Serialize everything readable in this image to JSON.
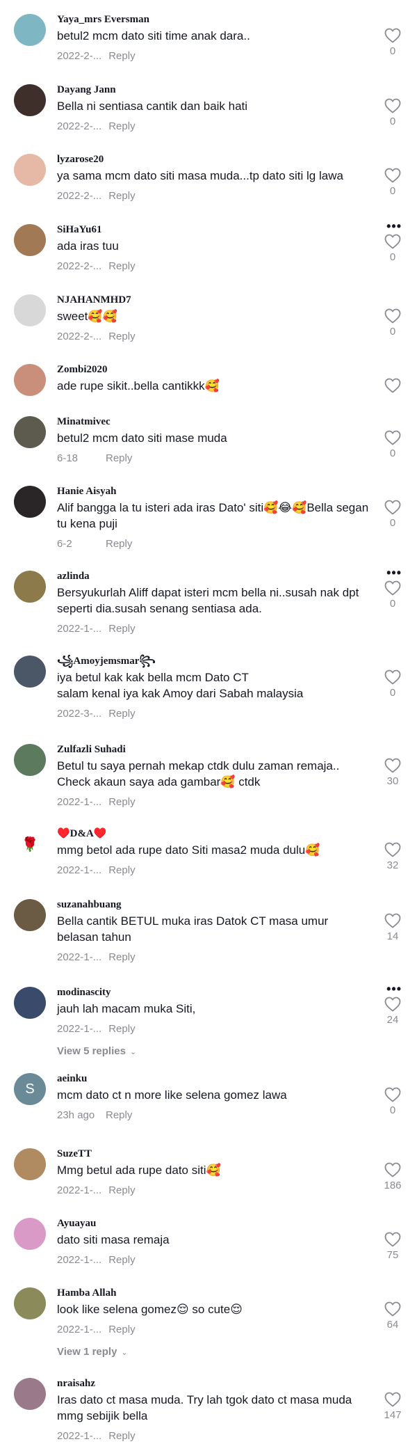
{
  "comments": [
    {
      "username": "Yaya_mrs Eversman",
      "text": "betul2 mcm dato siti time anak dara..",
      "date": "2022-2-...",
      "reply": "Reply",
      "likes": "0",
      "more": false,
      "avatar_color": "#7fb6c4",
      "avatar_letter": ""
    },
    {
      "username": "Dayang Jann",
      "text": "Bella ni sentiasa cantik dan baik hati",
      "date": "2022-2-...",
      "reply": "Reply",
      "likes": "0",
      "more": false,
      "avatar_color": "#3e2f2a",
      "avatar_letter": ""
    },
    {
      "username": "lyzarose20",
      "text": "ya sama mcm dato siti masa muda...tp dato siti lg lawa",
      "date": "2022-2-...",
      "reply": "Reply",
      "likes": "0",
      "more": false,
      "avatar_color": "#e6b8a6",
      "avatar_letter": ""
    },
    {
      "username": "SiHaYu61",
      "text": "ada iras tuu",
      "date": "2022-2-...",
      "reply": "Reply",
      "likes": "0",
      "more": true,
      "avatar_color": "#a17a55",
      "avatar_letter": ""
    },
    {
      "username": "NJAHANMHD7",
      "text": "sweet🥰🥰",
      "date": "2022-2-...",
      "reply": "Reply",
      "likes": "0",
      "more": false,
      "avatar_color": "#d8d8d8",
      "avatar_letter": ""
    },
    {
      "username": "Zombi2020",
      "text": "ade rupe sikit..bella cantikkk🥰",
      "date": "",
      "reply": "",
      "likes": "",
      "more": false,
      "avatar_color": "#c98f7a",
      "avatar_letter": ""
    },
    {
      "username": "Minatmivec",
      "text": "betul2 mcm dato siti mase muda",
      "date": "6-18",
      "reply": "Reply",
      "likes": "0",
      "more": false,
      "avatar_color": "#5d5a4e",
      "avatar_letter": ""
    },
    {
      "username": "Hanie Aisyah",
      "text": "Alif bangga la tu isteri ada iras Dato' siti🥰😂🥰Bella segan tu kena puji",
      "date": "6-2",
      "reply": "Reply",
      "likes": "0",
      "more": false,
      "avatar_color": "#2a2526",
      "avatar_letter": ""
    },
    {
      "username": "azlinda",
      "text": "Bersyukurlah Aliff dapat isteri mcm bella ni..susah nak dpt seperti dia.susah senang sentiasa ada.",
      "date": "2022-1-...",
      "reply": "Reply",
      "likes": "0",
      "more": true,
      "avatar_color": "#8c7a4b",
      "avatar_letter": ""
    },
    {
      "username": "꧁Amoyjemsmar꧂",
      "text": "iya betul kak kak bella mcm Dato CT\nsalam kenal iya kak Amoy dari Sabah malaysia",
      "date": "2022-3-...",
      "reply": "Reply",
      "likes": "0",
      "more": false,
      "avatar_color": "#4b5666",
      "avatar_letter": ""
    },
    {
      "username": "Zulfazli Suhadi",
      "text": "Betul tu saya pernah mekap ctdk dulu zaman remaja..\nCheck akaun saya ada gambar🥰 ctdk",
      "date": "2022-1-...",
      "reply": "Reply",
      "likes": "30",
      "more": false,
      "avatar_color": "#5b7a5e",
      "avatar_letter": ""
    },
    {
      "username": "♥️D&A♥️",
      "text": "mmg betol ada rupe dato Siti masa2 muda dulu🥰",
      "date": "2022-1-...",
      "reply": "Reply",
      "likes": "32",
      "more": false,
      "avatar_color": "#ffffff",
      "avatar_letter": "🌹"
    },
    {
      "username": "suzanahbuang",
      "text": "Bella cantik BETUL muka iras Datok CT masa umur belasan tahun",
      "date": "2022-1-...",
      "reply": "Reply",
      "likes": "14",
      "more": false,
      "avatar_color": "#6b5a44",
      "avatar_letter": ""
    },
    {
      "username": "modinascity",
      "text": "jauh lah macam muka Siti,",
      "date": "2022-1-...",
      "reply": "Reply",
      "likes": "24",
      "more": true,
      "avatar_color": "#3a4a6a",
      "avatar_letter": "",
      "replies": "View 5 replies"
    },
    {
      "username": "aeinku",
      "text": "mcm dato ct n more like selena gomez lawa",
      "date": "23h ago",
      "reply": "Reply",
      "likes": "0",
      "more": false,
      "avatar_color": "#6a8a98",
      "avatar_letter": "S"
    },
    {
      "username": "SuzeTT",
      "text": "Mmg betul ada rupe dato siti🥰",
      "date": "2022-1-...",
      "reply": "Reply",
      "likes": "186",
      "more": false,
      "avatar_color": "#b08a60",
      "avatar_letter": ""
    },
    {
      "username": "Ayuayau",
      "text": "dato siti masa remaja",
      "date": "2022-1-...",
      "reply": "Reply",
      "likes": "75",
      "more": false,
      "avatar_color": "#d99ac8",
      "avatar_letter": ""
    },
    {
      "username": "Hamba Allah",
      "text": "look like selena gomez😌 so cute😌",
      "date": "2022-1-...",
      "reply": "Reply",
      "likes": "64",
      "more": false,
      "avatar_color": "#8a8a5a",
      "avatar_letter": "",
      "replies": "View 1 reply"
    },
    {
      "username": "nraisahz",
      "text": "Iras dato ct masa muda. Try lah tgok dato ct masa muda mmg sebijik bella",
      "date": "2022-1-...",
      "reply": "Reply",
      "likes": "147",
      "more": false,
      "avatar_color": "#9a7a8a",
      "avatar_letter": ""
    }
  ],
  "icons": {
    "like": "heart-outline-icon",
    "more": "more-dots-icon",
    "expand": "chevron-down-icon"
  },
  "colors": {
    "primary_text": "#161823",
    "secondary_text": "#8a8b91"
  }
}
